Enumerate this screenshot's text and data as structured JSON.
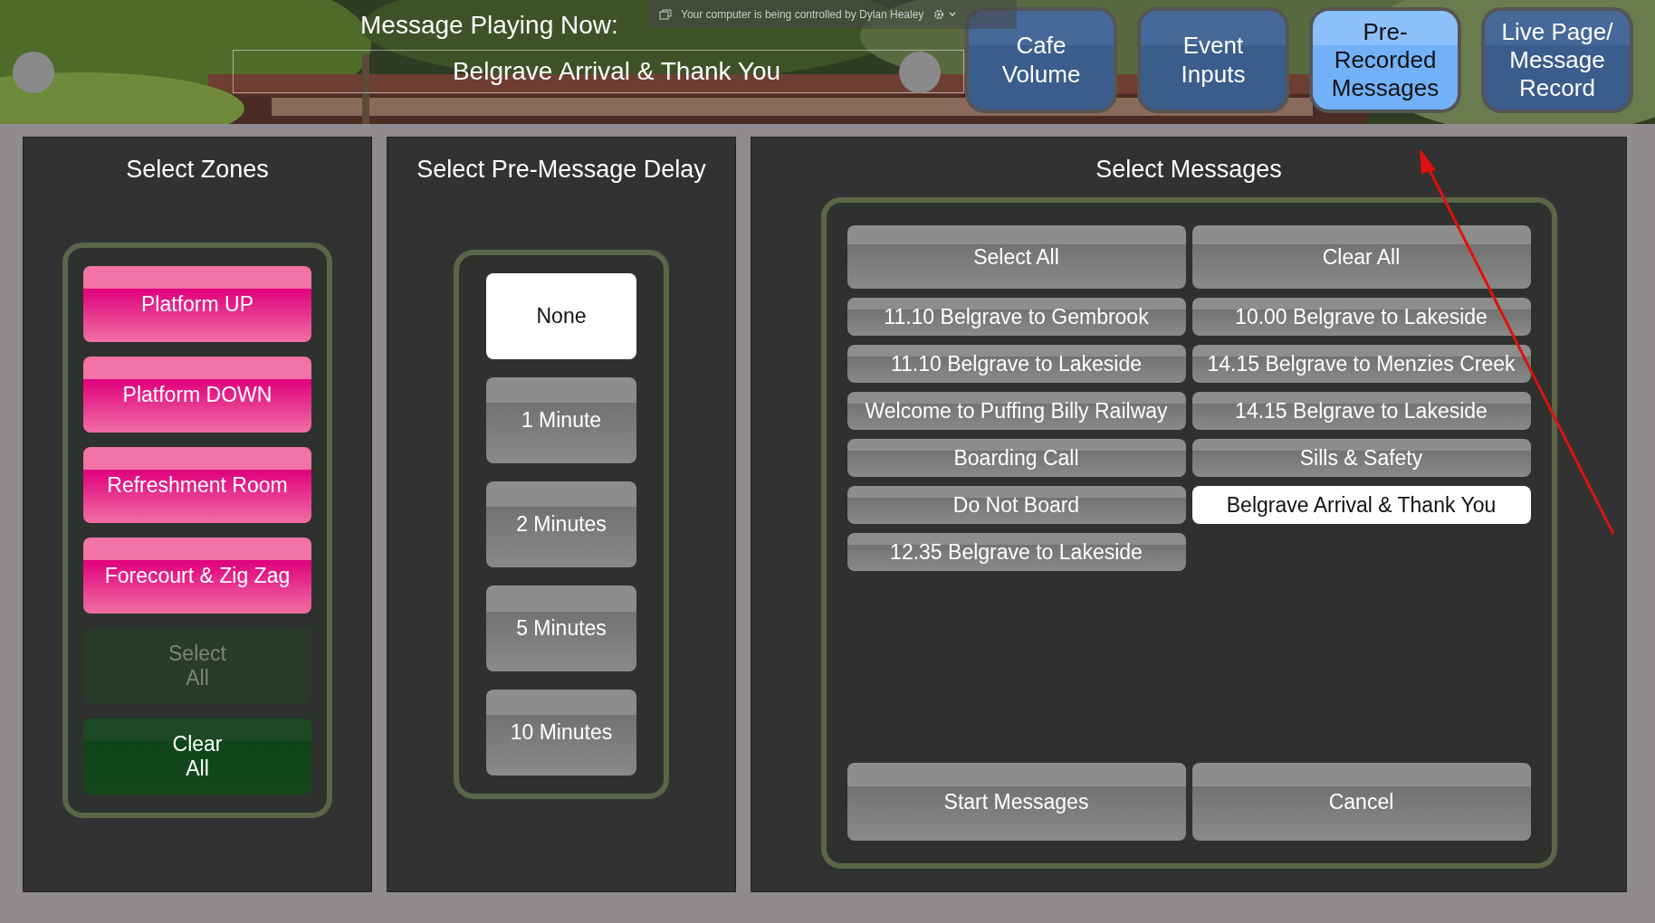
{
  "remote_banner": {
    "text": "Your computer is being controlled by Dylan Healey"
  },
  "now_playing": {
    "label": "Message Playing Now:",
    "value": "Belgrave Arrival & Thank You"
  },
  "tabs": [
    {
      "label": "Cafe Volume",
      "selected": false
    },
    {
      "label": "Event Inputs",
      "selected": false
    },
    {
      "label": "Pre-Recorded Messages",
      "selected": true
    },
    {
      "label": "Live Page/ Message Record",
      "selected": false
    }
  ],
  "zones": {
    "title": "Select Zones",
    "items": [
      {
        "label": "Platform UP",
        "selected": true
      },
      {
        "label": "Platform DOWN",
        "selected": true
      },
      {
        "label": "Refreshment Room",
        "selected": true
      },
      {
        "label": "Forecourt & Zig Zag",
        "selected": true
      }
    ],
    "actions": [
      {
        "label": "Select All",
        "disabled": true
      },
      {
        "label": "Clear All",
        "disabled": false
      }
    ]
  },
  "delay": {
    "title": "Select Pre-Message Delay",
    "options": [
      {
        "label": "None",
        "selected": true
      },
      {
        "label": "1 Minute",
        "selected": false
      },
      {
        "label": "2 Minutes",
        "selected": false
      },
      {
        "label": "5 Minutes",
        "selected": false
      },
      {
        "label": "10 Minutes",
        "selected": false
      }
    ]
  },
  "messages": {
    "title": "Select Messages",
    "actions": [
      "Select All",
      "Clear All"
    ],
    "items": [
      {
        "label": "11.10 Belgrave to Gembrook",
        "selected": false
      },
      {
        "label": "10.00 Belgrave to Lakeside",
        "selected": false
      },
      {
        "label": "11.10 Belgrave to Lakeside",
        "selected": false
      },
      {
        "label": "14.15 Belgrave to Menzies Creek",
        "selected": false
      },
      {
        "label": "Welcome to Puffing Billy Railway",
        "selected": false
      },
      {
        "label": "14.15 Belgrave to Lakeside",
        "selected": false
      },
      {
        "label": "Boarding Call",
        "selected": false
      },
      {
        "label": "Sills & Safety",
        "selected": false
      },
      {
        "label": "Do Not Board",
        "selected": false
      },
      {
        "label": "Belgrave Arrival & Thank You",
        "selected": true
      },
      {
        "label": "12.35 Belgrave to Lakeside",
        "selected": false
      }
    ],
    "buttons": [
      "Start Messages",
      "Cancel"
    ]
  }
}
